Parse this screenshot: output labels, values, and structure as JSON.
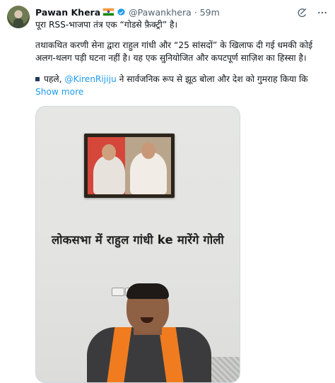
{
  "author": {
    "name": "Pawan Khera",
    "handle": "@Pawankhera",
    "separator": "·",
    "time": "59m"
  },
  "icons": {
    "flag": "india-flag-icon",
    "verified": "verified-badge-icon",
    "grok": "grok-icon",
    "more": "more-icon"
  },
  "colors": {
    "link": "#1d9bf0",
    "verified": "#1d9bf0",
    "text": "#0f1419",
    "muted": "#536471"
  },
  "tweet": {
    "line1": "पूरा RSS-भाजपा तंत्र एक “गोडसे फ़ैक्ट्री” है।",
    "line2": "तथाकथित करणी सेना द्वारा राहुल गांधी और “25 सांसदों” के खिलाफ दी गई धमकी कोई",
    "line3": "अलग-थलग पड़ी घटना नहीं है। यह एक सुनियोजित और कपटपूर्ण साज़िश का हिस्सा है।",
    "bullet_pre": "पहले,",
    "bullet_mention": "@KirenRijiju",
    "bullet_post": "ने सार्वजनिक रूप से झूठ बोला और देश को गुमराह किया कि",
    "show_more": "Show more"
  },
  "media": {
    "caption": "लोकसभा में राहुल गांधी ke मारेंगे गोली"
  }
}
